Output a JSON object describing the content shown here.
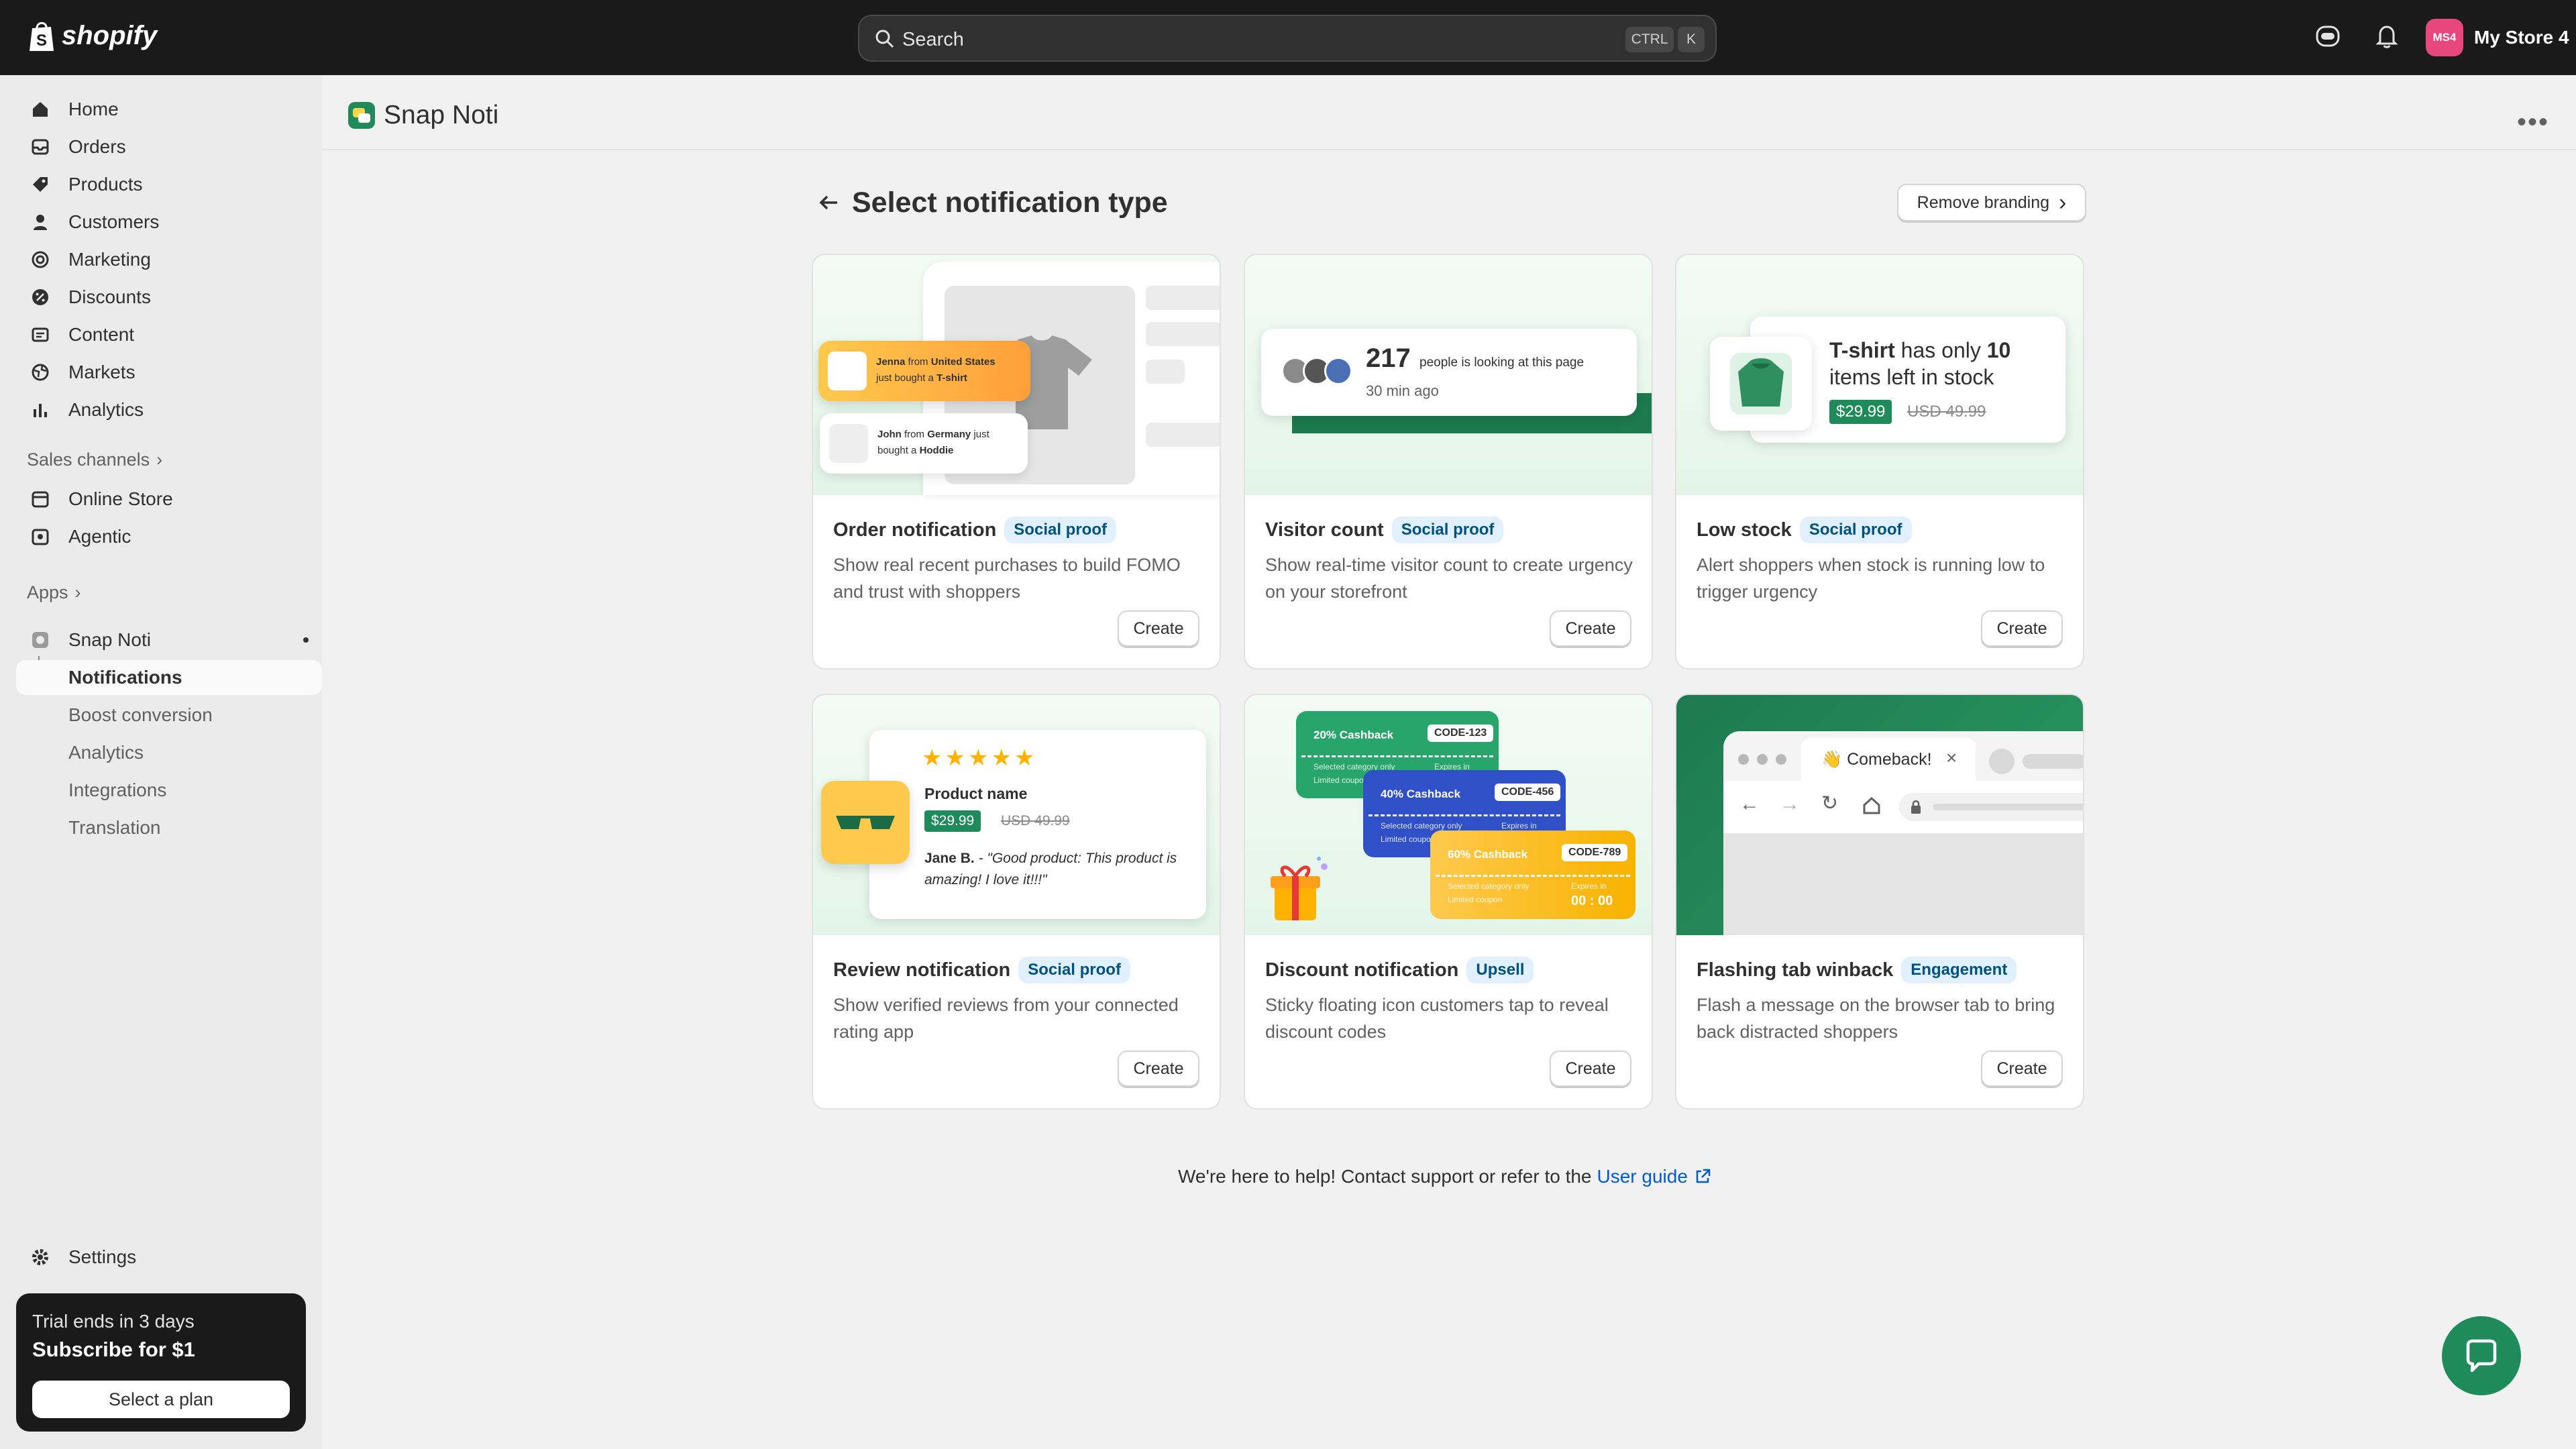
{
  "topbar": {
    "logo_text": "shopify",
    "search_placeholder": "Search",
    "shortcut_1": "CTRL",
    "shortcut_2": "K",
    "store_initials": "MS4",
    "store_name": "My Store 4"
  },
  "sidebar": {
    "items": [
      {
        "label": "Home",
        "icon": "home-icon"
      },
      {
        "label": "Orders",
        "icon": "inbox-icon"
      },
      {
        "label": "Products",
        "icon": "tag-icon"
      },
      {
        "label": "Customers",
        "icon": "person-icon"
      },
      {
        "label": "Marketing",
        "icon": "target-icon"
      },
      {
        "label": "Discounts",
        "icon": "discount-icon"
      },
      {
        "label": "Content",
        "icon": "content-icon"
      },
      {
        "label": "Markets",
        "icon": "globe-icon"
      },
      {
        "label": "Analytics",
        "icon": "bar-chart-icon"
      }
    ],
    "sales_channels_label": "Sales channels",
    "channels": [
      {
        "label": "Online Store",
        "icon": "store-icon"
      },
      {
        "label": "Agentic",
        "icon": "agentic-icon"
      }
    ],
    "apps_label": "Apps",
    "app_name": "Snap Noti",
    "app_subitems": [
      "Notifications",
      "Boost conversion",
      "Analytics",
      "Integrations",
      "Translation"
    ],
    "settings_label": "Settings",
    "trial": {
      "line1": "Trial ends in 3 days",
      "line2": "Subscribe for $1",
      "button": "Select a plan"
    }
  },
  "app_header": {
    "name": "Snap Noti"
  },
  "page": {
    "title": "Select notification type",
    "remove_branding": "Remove branding",
    "create_label": "Create",
    "help_text": "We're here to help! Contact support or refer to the",
    "help_link": "User guide"
  },
  "cards": [
    {
      "title": "Order notification",
      "badge": "Social proof",
      "desc": "Show real recent purchases to build FOMO and trust with shoppers"
    },
    {
      "title": "Visitor count",
      "badge": "Social proof",
      "desc": "Show real-time visitor count to create urgency on your storefront"
    },
    {
      "title": "Low stock",
      "badge": "Social proof",
      "desc": "Alert shoppers when stock is running low to trigger urgency"
    },
    {
      "title": "Review notification",
      "badge": "Social proof",
      "desc": "Show verified reviews from your connected rating app"
    },
    {
      "title": "Discount notification",
      "badge": "Upsell",
      "desc": "Sticky floating icon customers tap to reveal discount codes"
    },
    {
      "title": "Flashing tab winback",
      "badge": "Engagement",
      "desc": "Flash a message on the browser tab to bring back distracted shoppers"
    }
  ],
  "art": {
    "order": {
      "n1_name": "Jenna",
      "n1_from": "from",
      "n1_place": "United States",
      "n1_action": "just bought a",
      "n1_item": "T-shirt",
      "n2_name": "John",
      "n2_from": "from",
      "n2_place": "Germany",
      "n2_action": "just",
      "n2_action2": "bought a",
      "n2_item": "Hoddie"
    },
    "visitor": {
      "count": "217",
      "text": "people is looking at this page",
      "time": "30 min ago"
    },
    "lowstock": {
      "product": "T-shirt",
      "mid": "has only",
      "qty": "10",
      "rest": "items left in stock",
      "price": "$29.99",
      "old_price": "USD 49.99"
    },
    "review": {
      "product": "Product name",
      "price": "$29.99",
      "old_price": "USD 49.99",
      "author": "Jane B.",
      "quote": "- \"Good product: This product is amazing! I love it!!!\""
    },
    "discount": {
      "c1": "20% Cashback",
      "code1": "CODE-123",
      "c2": "40% Cashback",
      "code2": "CODE-456",
      "c3": "60% Cashback",
      "code3": "CODE-789",
      "small1": "Selected category only",
      "small2": "Limited coupon",
      "expires": "Expires in",
      "timer": "00 : 00"
    },
    "tab": {
      "title": "👋 Comeback!"
    }
  },
  "colors": {
    "brand_green": "#1f8a5a",
    "topbar": "#1a1a1a",
    "badge_bg": "#e0f0ff",
    "link": "#005bd3"
  }
}
